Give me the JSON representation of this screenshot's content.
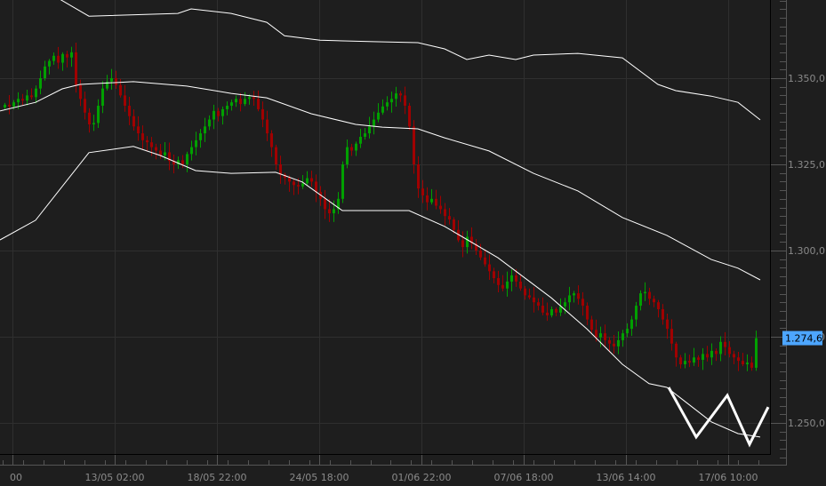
{
  "chart_data": {
    "type": "candlestick",
    "title": "",
    "xlabel": "",
    "ylabel": "",
    "ylim": [
      1.2385,
      1.3727
    ],
    "grid": true,
    "y_ticks": [
      1.25,
      1.275,
      1.3,
      1.325,
      1.35
    ],
    "y_tick_labels": [
      "1.250,0",
      "1.275,0",
      "1.300,0",
      "1.325,0",
      "1.350,0"
    ],
    "x_tick_labels": [
      "00",
      "13/05 02:00",
      "18/05 22:00",
      "24/05 18:00",
      "01/06 22:00",
      "07/06 18:00",
      "13/06 14:00",
      "17/06 10:00"
    ],
    "x_tick_candle_index": [
      1.8,
      24.8,
      47.8,
      70.8,
      93.8,
      116.8,
      139.8,
      162.8
    ],
    "current_price": {
      "value": 1.2746,
      "label": "1.274,6"
    },
    "colors": {
      "up": "#00a000",
      "down": "#a00000",
      "bands": "#ffffff",
      "price_tag": "#4da6ff",
      "background": "#1e1e1e",
      "grid": "#2f2f2f"
    },
    "close": [
      1.3423,
      1.3418,
      1.343,
      1.344,
      1.3435,
      1.345,
      1.3445,
      1.347,
      1.35,
      1.3534,
      1.355,
      1.3565,
      1.3545,
      1.357,
      1.356,
      1.3575,
      1.348,
      1.344,
      1.34,
      1.3366,
      1.337,
      1.342,
      1.347,
      1.349,
      1.35,
      1.348,
      1.345,
      1.342,
      1.339,
      1.336,
      1.334,
      1.332,
      1.3314,
      1.33,
      1.329,
      1.3276,
      1.3285,
      1.326,
      1.325,
      1.3262,
      1.325,
      1.328,
      1.33,
      1.332,
      1.334,
      1.336,
      1.338,
      1.3405,
      1.339,
      1.341,
      1.342,
      1.343,
      1.344,
      1.3425,
      1.344,
      1.3445,
      1.344,
      1.341,
      1.338,
      1.334,
      1.33,
      1.325,
      1.322,
      1.3211,
      1.32,
      1.319,
      1.3186,
      1.3195,
      1.321,
      1.32,
      1.317,
      1.315,
      1.312,
      1.3108,
      1.312,
      1.315,
      1.325,
      1.33,
      1.329,
      1.331,
      1.333,
      1.334,
      1.336,
      1.338,
      1.34,
      1.3418,
      1.343,
      1.344,
      1.3456,
      1.345,
      1.342,
      1.336,
      1.325,
      1.318,
      1.316,
      1.314,
      1.315,
      1.313,
      1.312,
      1.31,
      1.309,
      1.306,
      1.303,
      1.301,
      1.304,
      1.302,
      1.3,
      1.298,
      1.296,
      1.294,
      1.292,
      1.29,
      1.289,
      1.291,
      1.2928,
      1.291,
      1.289,
      1.287,
      1.2864,
      1.285,
      1.284,
      1.282,
      1.2812,
      1.283,
      1.282,
      1.2838,
      1.285,
      1.287,
      1.2876,
      1.286,
      1.284,
      1.28,
      1.277,
      1.2748,
      1.276,
      1.274,
      1.273,
      1.2722,
      1.274,
      1.276,
      1.2773,
      1.28,
      1.284,
      1.2876,
      1.288,
      1.286,
      1.285,
      1.283,
      1.28,
      1.2773,
      1.273,
      1.269,
      1.267,
      1.268,
      1.2675,
      1.269,
      1.2683,
      1.27,
      1.269,
      1.2709,
      1.27,
      1.2735,
      1.272,
      1.27,
      1.269,
      1.268,
      1.267,
      1.2675,
      1.266,
      1.2746
    ],
    "first_open": 1.3415,
    "bands": {
      "upper": [
        [
          -1,
          1.38
        ],
        [
          11,
          1.374
        ],
        [
          19,
          1.368
        ],
        [
          39,
          1.3688
        ],
        [
          42,
          1.3701
        ],
        [
          51,
          1.3688
        ],
        [
          59,
          1.3662
        ],
        [
          63,
          1.3623
        ],
        [
          71,
          1.361
        ],
        [
          83,
          1.3606
        ],
        [
          93,
          1.3603
        ],
        [
          99,
          1.3585
        ],
        [
          104,
          1.3554
        ],
        [
          109,
          1.3567
        ],
        [
          115,
          1.3554
        ],
        [
          119,
          1.3567
        ],
        [
          129,
          1.3572
        ],
        [
          139,
          1.3559
        ],
        [
          147,
          1.3482
        ],
        [
          151,
          1.3464
        ],
        [
          159,
          1.3448
        ],
        [
          165,
          1.343
        ],
        [
          170,
          1.3379
        ]
      ],
      "middle": [
        [
          -1,
          1.3405
        ],
        [
          7,
          1.343
        ],
        [
          13,
          1.3469
        ],
        [
          17,
          1.3482
        ],
        [
          29,
          1.349
        ],
        [
          41,
          1.3477
        ],
        [
          51,
          1.3456
        ],
        [
          59,
          1.3443
        ],
        [
          69,
          1.3397
        ],
        [
          79,
          1.3366
        ],
        [
          85,
          1.3358
        ],
        [
          93,
          1.3353
        ],
        [
          99,
          1.3327
        ],
        [
          109,
          1.3289
        ],
        [
          119,
          1.3224
        ],
        [
          129,
          1.3173
        ],
        [
          139,
          1.3096
        ],
        [
          149,
          1.3044
        ],
        [
          159,
          1.2974
        ],
        [
          165,
          1.2949
        ],
        [
          170,
          1.2915
        ]
      ],
      "lower": [
        [
          -1,
          1.3031
        ],
        [
          7,
          1.3088
        ],
        [
          13,
          1.3186
        ],
        [
          19,
          1.3284
        ],
        [
          29,
          1.3302
        ],
        [
          35,
          1.3276
        ],
        [
          43,
          1.3232
        ],
        [
          51,
          1.3224
        ],
        [
          61,
          1.3227
        ],
        [
          67,
          1.3199
        ],
        [
          76,
          1.3116
        ],
        [
          91,
          1.3116
        ],
        [
          99,
          1.307
        ],
        [
          111,
          1.2979
        ],
        [
          123,
          1.2863
        ],
        [
          131,
          1.2773
        ],
        [
          139,
          1.267
        ],
        [
          145,
          1.2614
        ],
        [
          149,
          1.2603
        ],
        [
          159,
          1.2503
        ],
        [
          165,
          1.2469
        ],
        [
          170,
          1.2459
        ]
      ]
    },
    "annotation_w_pattern": [
      [
        149.4,
        1.2603
      ],
      [
        155.6,
        1.2459
      ],
      [
        162.6,
        1.258
      ],
      [
        167.6,
        1.2438
      ],
      [
        171.8,
        1.2546
      ]
    ]
  }
}
